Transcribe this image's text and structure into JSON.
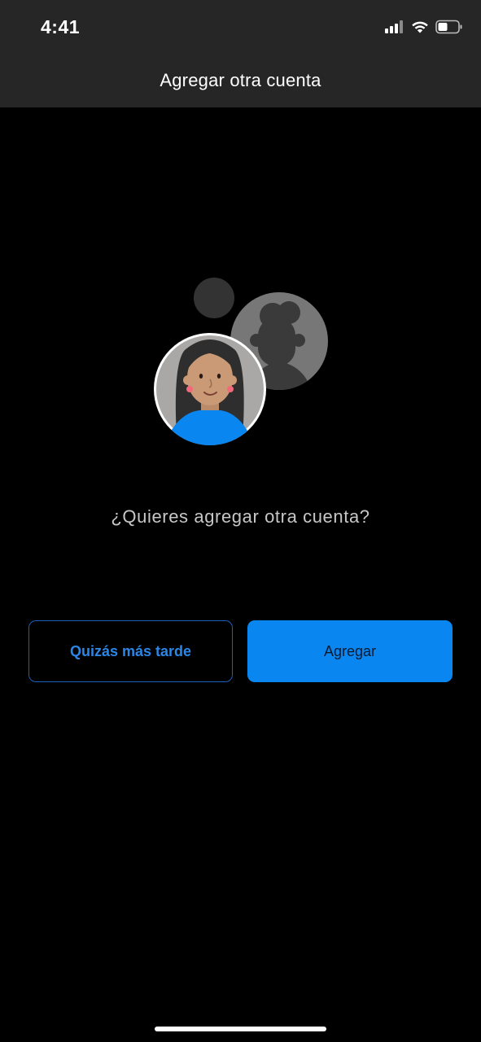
{
  "status_bar": {
    "time": "4:41",
    "icons": [
      "cellular-signal-icon",
      "wifi-icon",
      "battery-icon"
    ]
  },
  "header": {
    "title": "Agregar otra cuenta"
  },
  "prompt": {
    "question": "¿Quieres agregar otra cuenta?"
  },
  "actions": {
    "later_label": "Quizás más tarde",
    "add_label": "Agregar"
  },
  "colors": {
    "background": "#000000",
    "header_background": "#262626",
    "accent": "#0a86f0",
    "accent_text": "#2b86e6",
    "muted_text": "#c7c7c7"
  }
}
